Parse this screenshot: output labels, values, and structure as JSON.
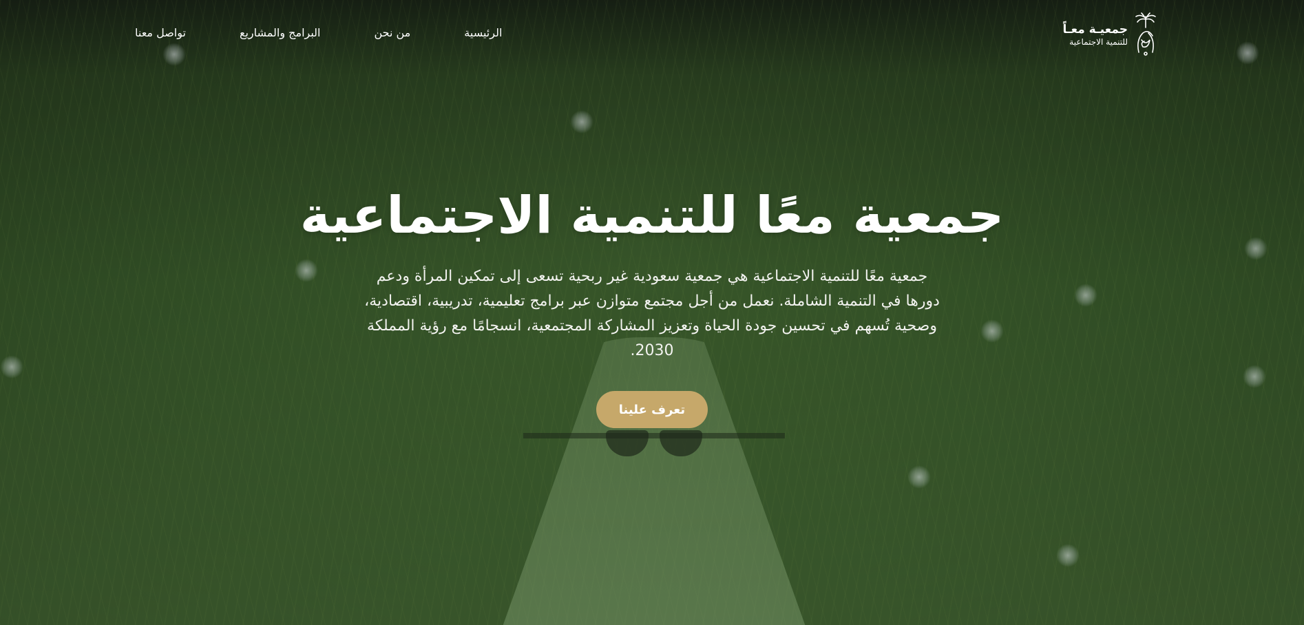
{
  "brand": {
    "name_line1": "جمعيـة معـاً",
    "name_line2": "للتنمية الاجتماعية",
    "logo_icon": "palm-swords-emblem"
  },
  "nav": {
    "items": [
      {
        "label": "الرئيسية"
      },
      {
        "label": "من نحن"
      },
      {
        "label": "البرامج والمشاريع"
      },
      {
        "label": "تواصل معنا"
      }
    ]
  },
  "hero": {
    "title": "جمعية معًا للتنمية الاجتماعية",
    "description": "جمعية معًا للتنمية الاجتماعية هي جمعية سعودية غير ربحية تسعى إلى تمكين المرأة ودعم دورها في التنمية الشاملة. نعمل من أجل مجتمع متوازن عبر برامج تعليمية، تدريبية، اقتصادية، وصحية تُسهم في تحسين جودة الحياة وتعزيز المشاركة المجتمعية، انسجامًا مع رؤية المملكة 2030.",
    "cta_label": "تعرف علينا"
  },
  "colors": {
    "accent": "#c6a86a",
    "overlay_green": "#3e5a2c",
    "text": "#ffffff"
  }
}
